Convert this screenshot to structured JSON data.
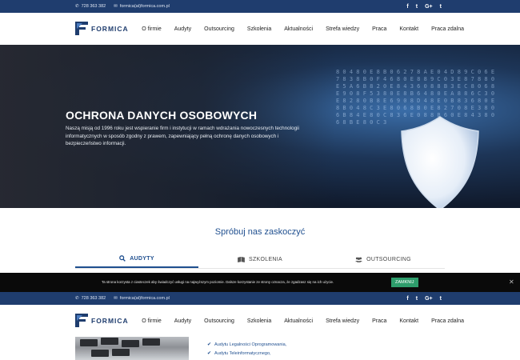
{
  "topbar": {
    "phone": "728 363 382",
    "email": "formica(at)formica.com.pl",
    "social": [
      {
        "icon": "facebook-icon",
        "glyph": "f"
      },
      {
        "icon": "twitter-icon",
        "glyph": "t"
      },
      {
        "icon": "google-plus-icon",
        "glyph": "G+"
      },
      {
        "icon": "tumblr-icon",
        "glyph": "t"
      }
    ]
  },
  "navbar": {
    "logo_text": "FORMICA",
    "menu": [
      "O firmie",
      "Audyty",
      "Outsourcing",
      "Szkolenia",
      "Aktualności",
      "Strefa wiedzy",
      "Praca",
      "Kontakt",
      "Praca zdalna"
    ]
  },
  "hero": {
    "title": "OCHRONA DANYCH OSOBOWYCH",
    "text": "Naszą misją od 1996 roku jest wspieranie firm i instytucji w ramach wdrażania nowoczesnych technologii informatycznych w sposób zgodny z prawem, zapewniający pełną ochronę danych osobowych i bezpieczeństwo informacji."
  },
  "section": {
    "title": "Spróbuj nas zaskoczyć",
    "tabs": [
      {
        "label": "AUDYTY",
        "icon": "search-icon",
        "active": true
      },
      {
        "label": "SZKOLENIA",
        "icon": "book-icon",
        "active": false
      },
      {
        "label": "OUTSOURCING",
        "icon": "users-icon",
        "active": false
      }
    ]
  },
  "cookie": {
    "message": "Ta strona korzysta z ciasteczek aby świadczyć usługi na najwyższym poziomie. Dalsze korzystanie ze strony oznacza, że zgadzasz się na ich użycie.",
    "button": "ZAMKNIJ"
  },
  "sticky": {
    "phone": "728 363 382",
    "email": "formica(at)formica.com.pl",
    "logo_text": "FORMICA",
    "menu": [
      "O firmie",
      "Audyty",
      "Outsourcing",
      "Szkolenia",
      "Aktualności",
      "Strefa wiedzy",
      "Praca",
      "Kontakt",
      "Praca zdalna"
    ]
  },
  "lower_list": [
    "Audytu Legalności Oprogramowania,",
    "Audytu Teleinformatycznego,"
  ],
  "colors": {
    "brand": "#1f3d6e",
    "accent": "#1f4f8f",
    "cookie_button": "#2e9d6c"
  }
}
